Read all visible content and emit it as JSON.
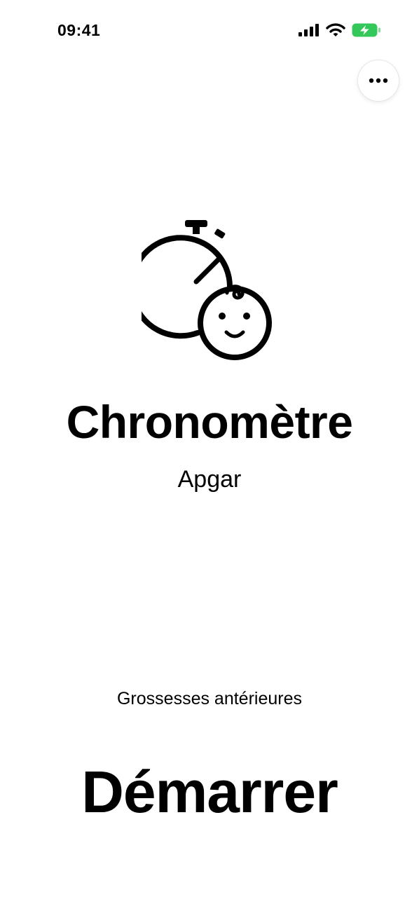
{
  "status_bar": {
    "time": "09:41",
    "icons": [
      "cellular-signal-icon",
      "wifi-icon",
      "battery-charging-icon"
    ],
    "battery_color": "#34c759"
  },
  "toolbar": {
    "more_icon": "ellipsis-icon"
  },
  "hero": {
    "icon": "stopwatch-baby-icon",
    "title": "Chronomètre",
    "subtitle": "Apgar"
  },
  "actions": {
    "history_label": "Grossesses antérieures",
    "start_label": "Démarrer"
  }
}
